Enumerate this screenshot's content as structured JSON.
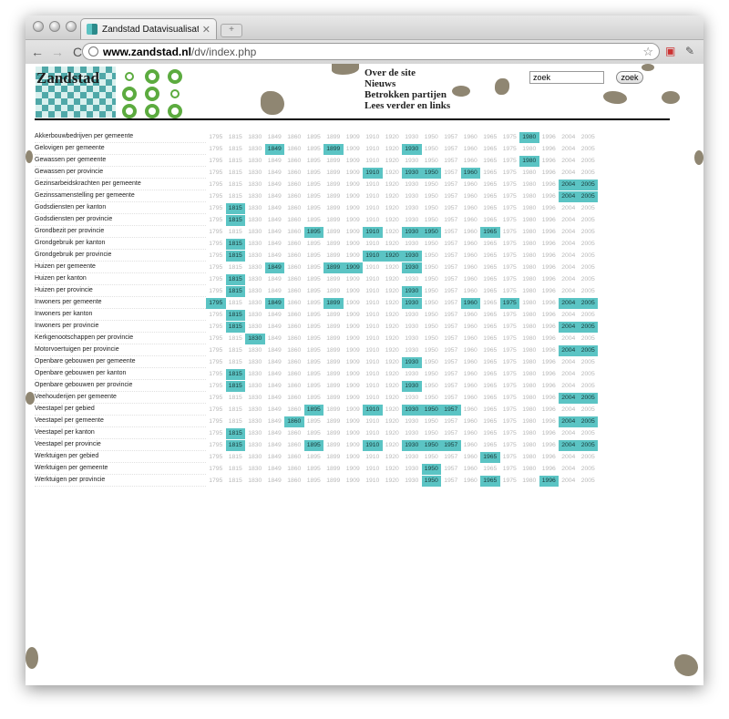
{
  "browser": {
    "tab_title": "Zandstad Datavisualisaties",
    "tab_close": "✕",
    "new_tab": "+",
    "url_host": "www.zandstad.nl",
    "url_path": "/dv/index.php"
  },
  "site": {
    "logo": "Zandstad",
    "nav": [
      "Over de site",
      "Nieuws",
      "Betrokken partijen",
      "Lees verder en links"
    ],
    "search_value": "zoek",
    "search_button": "zoek"
  },
  "years": [
    "1795",
    "1815",
    "1830",
    "1849",
    "1860",
    "1895",
    "1899",
    "1909",
    "1910",
    "1920",
    "1930",
    "1950",
    "1957",
    "1960",
    "1965",
    "1975",
    "1980",
    "1996",
    "2004",
    "2005"
  ],
  "datasets": [
    {
      "label": "Akkerbouwbedrijven per gemeente",
      "active": [
        "1980"
      ]
    },
    {
      "label": "Gelovigen per gemeente",
      "active": [
        "1849",
        "1899",
        "1930"
      ]
    },
    {
      "label": "Gewassen per gemeente",
      "active": [
        "1980"
      ]
    },
    {
      "label": "Gewassen per provincie",
      "active": [
        "1910",
        "1930",
        "1950",
        "1960"
      ]
    },
    {
      "label": "Gezinsarbeidskrachten per gemeente",
      "active": [
        "2004",
        "2005"
      ]
    },
    {
      "label": "Gezinssamenstelling per gemeente",
      "active": [
        "2004",
        "2005"
      ]
    },
    {
      "label": "Godsdiensten per kanton",
      "active": [
        "1815"
      ]
    },
    {
      "label": "Godsdiensten per provincie",
      "active": [
        "1815"
      ]
    },
    {
      "label": "Grondbezit per provincie",
      "active": [
        "1895",
        "1910",
        "1930",
        "1950",
        "1965"
      ]
    },
    {
      "label": "Grondgebruik per kanton",
      "active": [
        "1815"
      ]
    },
    {
      "label": "Grondgebruik per provincie",
      "active": [
        "1815",
        "1910",
        "1920",
        "1930"
      ]
    },
    {
      "label": "Huizen per gemeente",
      "active": [
        "1849",
        "1899",
        "1909",
        "1930"
      ]
    },
    {
      "label": "Huizen per kanton",
      "active": [
        "1815"
      ]
    },
    {
      "label": "Huizen per provincie",
      "active": [
        "1815",
        "1930"
      ]
    },
    {
      "label": "Inwoners per gemeente",
      "active": [
        "1795",
        "1849",
        "1899",
        "1930",
        "1960",
        "1975",
        "2004",
        "2005"
      ]
    },
    {
      "label": "Inwoners per kanton",
      "active": [
        "1815"
      ]
    },
    {
      "label": "Inwoners per provincie",
      "active": [
        "1815",
        "2004",
        "2005"
      ]
    },
    {
      "label": "Kerkgenootschappen per provincie",
      "active": [
        "1830"
      ]
    },
    {
      "label": "Motorvoertuigen per provincie",
      "active": [
        "2004",
        "2005"
      ]
    },
    {
      "label": "Openbare gebouwen per gemeente",
      "active": [
        "1930"
      ]
    },
    {
      "label": "Openbare gebouwen per kanton",
      "active": [
        "1815"
      ]
    },
    {
      "label": "Openbare gebouwen per provincie",
      "active": [
        "1815",
        "1930"
      ]
    },
    {
      "label": "Veehouderijen per gemeente",
      "active": [
        "2004",
        "2005"
      ]
    },
    {
      "label": "Veestapel per gebied",
      "active": [
        "1895",
        "1910",
        "1930",
        "1950",
        "1957"
      ]
    },
    {
      "label": "Veestapel per gemeente",
      "active": [
        "1860",
        "2004",
        "2005"
      ]
    },
    {
      "label": "Veestapel per kanton",
      "active": [
        "1815"
      ]
    },
    {
      "label": "Veestapel per provincie",
      "active": [
        "1815",
        "1895",
        "1910",
        "1930",
        "1950",
        "1957",
        "2004",
        "2005"
      ]
    },
    {
      "label": "Werktuigen per gebied",
      "active": [
        "1965"
      ]
    },
    {
      "label": "Werktuigen per gemeente",
      "active": [
        "1950"
      ]
    },
    {
      "label": "Werktuigen per provincie",
      "active": [
        "1950",
        "1965",
        "1996"
      ]
    }
  ]
}
